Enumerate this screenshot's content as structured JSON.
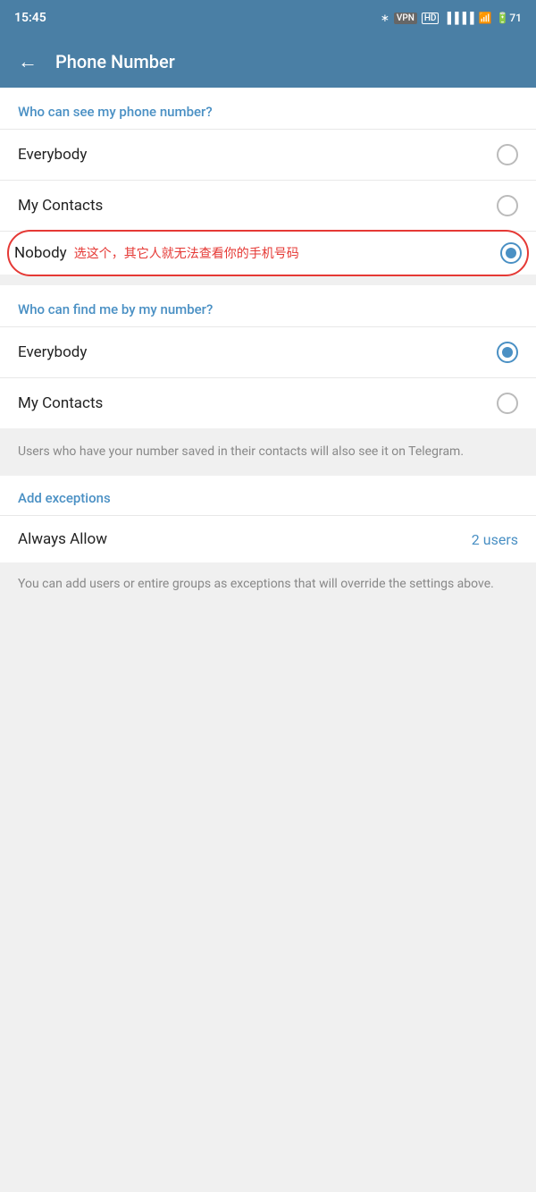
{
  "statusBar": {
    "time": "15:45",
    "icons": [
      "bluetooth",
      "vpn",
      "hd",
      "signal",
      "wifi",
      "battery"
    ]
  },
  "header": {
    "back_label": "←",
    "title": "Phone Number"
  },
  "section1": {
    "header": "Who can see my phone number?",
    "options": [
      {
        "label": "Everybody",
        "selected": false
      },
      {
        "label": "My Contacts",
        "selected": false
      },
      {
        "label": "Nobody",
        "selected": true,
        "annotation": "选这个，其它人就无法查看你的手机号码"
      }
    ]
  },
  "section2": {
    "header": "Who can find me by my number?",
    "options": [
      {
        "label": "Everybody",
        "selected": true
      },
      {
        "label": "My Contacts",
        "selected": false
      }
    ],
    "info": "Users who have your number saved in their contacts will also see it on Telegram."
  },
  "exceptions": {
    "header": "Add exceptions",
    "always_allow_label": "Always Allow",
    "users_count": "2 users",
    "info": "You can add users or entire groups as exceptions that will override the settings above."
  }
}
